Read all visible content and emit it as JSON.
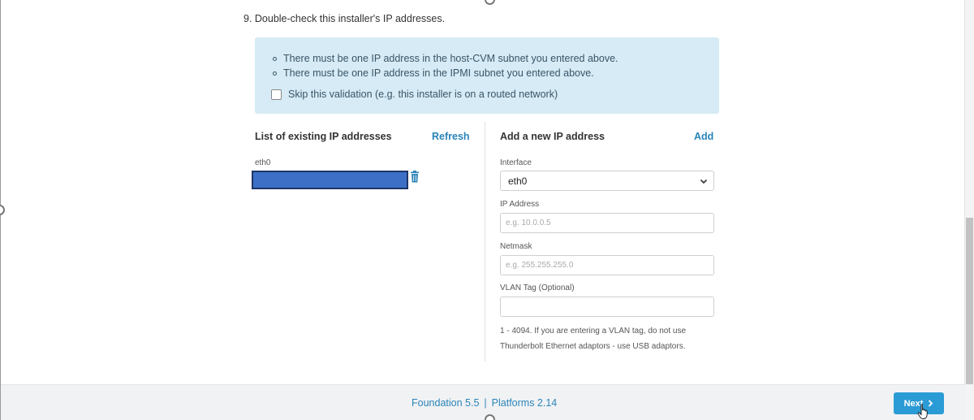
{
  "step": {
    "title": "9. Double-check this installer's IP addresses."
  },
  "info": {
    "bullets": [
      "There must be one IP address in the host-CVM subnet you entered above.",
      "There must be one IP address in the IPMI subnet you entered above."
    ],
    "skip_label": "Skip this validation (e.g. this installer is on a routed network)",
    "skip_checked": false
  },
  "existing": {
    "heading": "List of existing IP addresses",
    "refresh_label": "Refresh",
    "interface_label": "eth0",
    "ip_value_redacted": true,
    "delete_icon": "trash-icon"
  },
  "new_ip": {
    "heading": "Add a new IP address",
    "add_label": "Add",
    "interface_label": "Interface",
    "interface_value": "eth0",
    "ip_label": "IP Address",
    "ip_placeholder": "e.g. 10.0.0.5",
    "netmask_label": "Netmask",
    "netmask_placeholder": "e.g. 255.255.255.0",
    "vlan_label": "VLAN Tag (Optional)",
    "vlan_value": "",
    "vlan_hint_line1": "1 - 4094. If you are entering a VLAN tag, do not use",
    "vlan_hint_line2": "Thunderbolt Ethernet adaptors - use USB adaptors."
  },
  "footer": {
    "foundation": "Foundation 5.5",
    "separator": "|",
    "platforms": "Platforms 2.14",
    "next_label": "Next"
  },
  "colors": {
    "accent": "#2a84b8",
    "info_bg": "#d6ebf5",
    "next_button": "#2b9bd6",
    "redaction": "#3d6fc7"
  }
}
